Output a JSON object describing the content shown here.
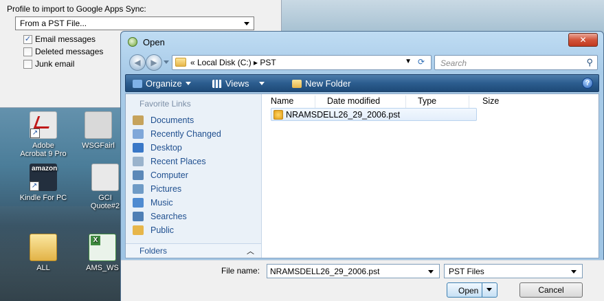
{
  "import_panel": {
    "label": "Profile to import to Google Apps Sync:",
    "profile_select": "From a PST File...",
    "checkboxes": [
      {
        "label": "Email messages",
        "checked": true
      },
      {
        "label": "Deleted messages",
        "checked": false
      },
      {
        "label": "Junk email",
        "checked": false
      }
    ]
  },
  "desktop": {
    "icons": [
      {
        "label_line1": "Adobe",
        "label_line2": "Acrobat 9 Pro",
        "icon": "pdf-icon",
        "color": "#e9e9e9"
      },
      {
        "label_line1": "WSGFairl",
        "label_line2": "",
        "icon": "document-icon",
        "color": "#d9d9d9"
      },
      {
        "label_line1": "Kindle For PC",
        "label_line2": "",
        "icon": "amazon-icon",
        "color": "#232f3e",
        "badge": "amazon"
      },
      {
        "label_line1": "GCI",
        "label_line2": "Quote#2",
        "icon": "document-icon",
        "color": "#e9e9e9"
      },
      {
        "label_line1": "ALL",
        "label_line2": "",
        "icon": "folder-icon",
        "color": "#f5d56a"
      },
      {
        "label_line1": "AMS_WS",
        "label_line2": "",
        "icon": "excel-icon",
        "color": "#3f8a3f"
      }
    ]
  },
  "dialog": {
    "title": "Open",
    "address": {
      "back_char": "‹",
      "crumbs": "«  Local Disk (C:)  ▸  PST"
    },
    "search": {
      "placeholder": "Search"
    },
    "toolbar": {
      "organize": "Organize",
      "views": "Views",
      "new_folder": "New Folder"
    },
    "nav": {
      "header": "Favorite Links",
      "items": [
        {
          "label": "Documents",
          "color": "#c6a35c"
        },
        {
          "label": "Recently Changed",
          "color": "#7fa7d9"
        },
        {
          "label": "Desktop",
          "color": "#3a78c7"
        },
        {
          "label": "Recent Places",
          "color": "#9ab3cc"
        },
        {
          "label": "Computer",
          "color": "#5b88b8"
        },
        {
          "label": "Pictures",
          "color": "#6f9bc6"
        },
        {
          "label": "Music",
          "color": "#4f8bd1"
        },
        {
          "label": "Searches",
          "color": "#4f7fb5"
        },
        {
          "label": "Public",
          "color": "#e7b64a"
        }
      ],
      "folders": "Folders"
    },
    "columns": [
      "Name",
      "Date modified",
      "Type",
      "Size"
    ],
    "files": [
      {
        "name": "NRAMSDELL26_29_2006.pst"
      }
    ],
    "file_name_label": "File name:",
    "file_name_value": "NRAMSDELL26_29_2006.pst",
    "file_type": "PST Files",
    "open": "Open",
    "cancel": "Cancel"
  }
}
